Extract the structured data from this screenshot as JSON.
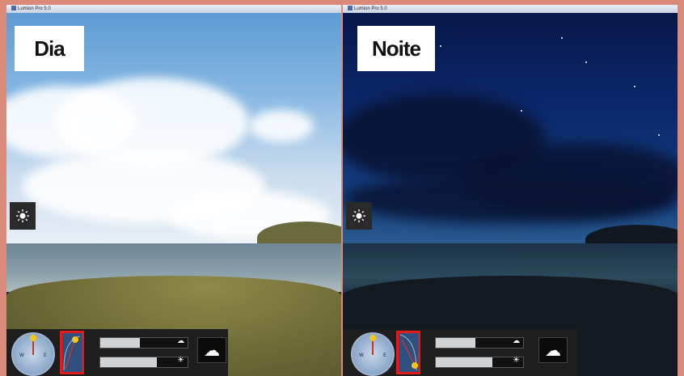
{
  "panels": [
    {
      "window_title": "Lumion Pro 5.0",
      "label": "Dia",
      "icons": {
        "sun_button": "sun-icon",
        "compass": "compass-icon",
        "weather": "cloud-icon"
      },
      "sliders": [
        {
          "icon": "cloud-icon",
          "level": 0.45
        },
        {
          "icon": "sun-icon",
          "level": 0.65
        }
      ]
    },
    {
      "window_title": "Lumion Pro 5.0",
      "label": "Noite",
      "icons": {
        "sun_button": "sun-icon",
        "compass": "compass-icon",
        "weather": "cloud-icon"
      },
      "sliders": [
        {
          "icon": "cloud-icon",
          "level": 0.45
        },
        {
          "icon": "sun-icon",
          "level": 0.65
        }
      ]
    }
  ],
  "colors": {
    "highlight": "#e51b1b",
    "frame": "#d98a78"
  }
}
